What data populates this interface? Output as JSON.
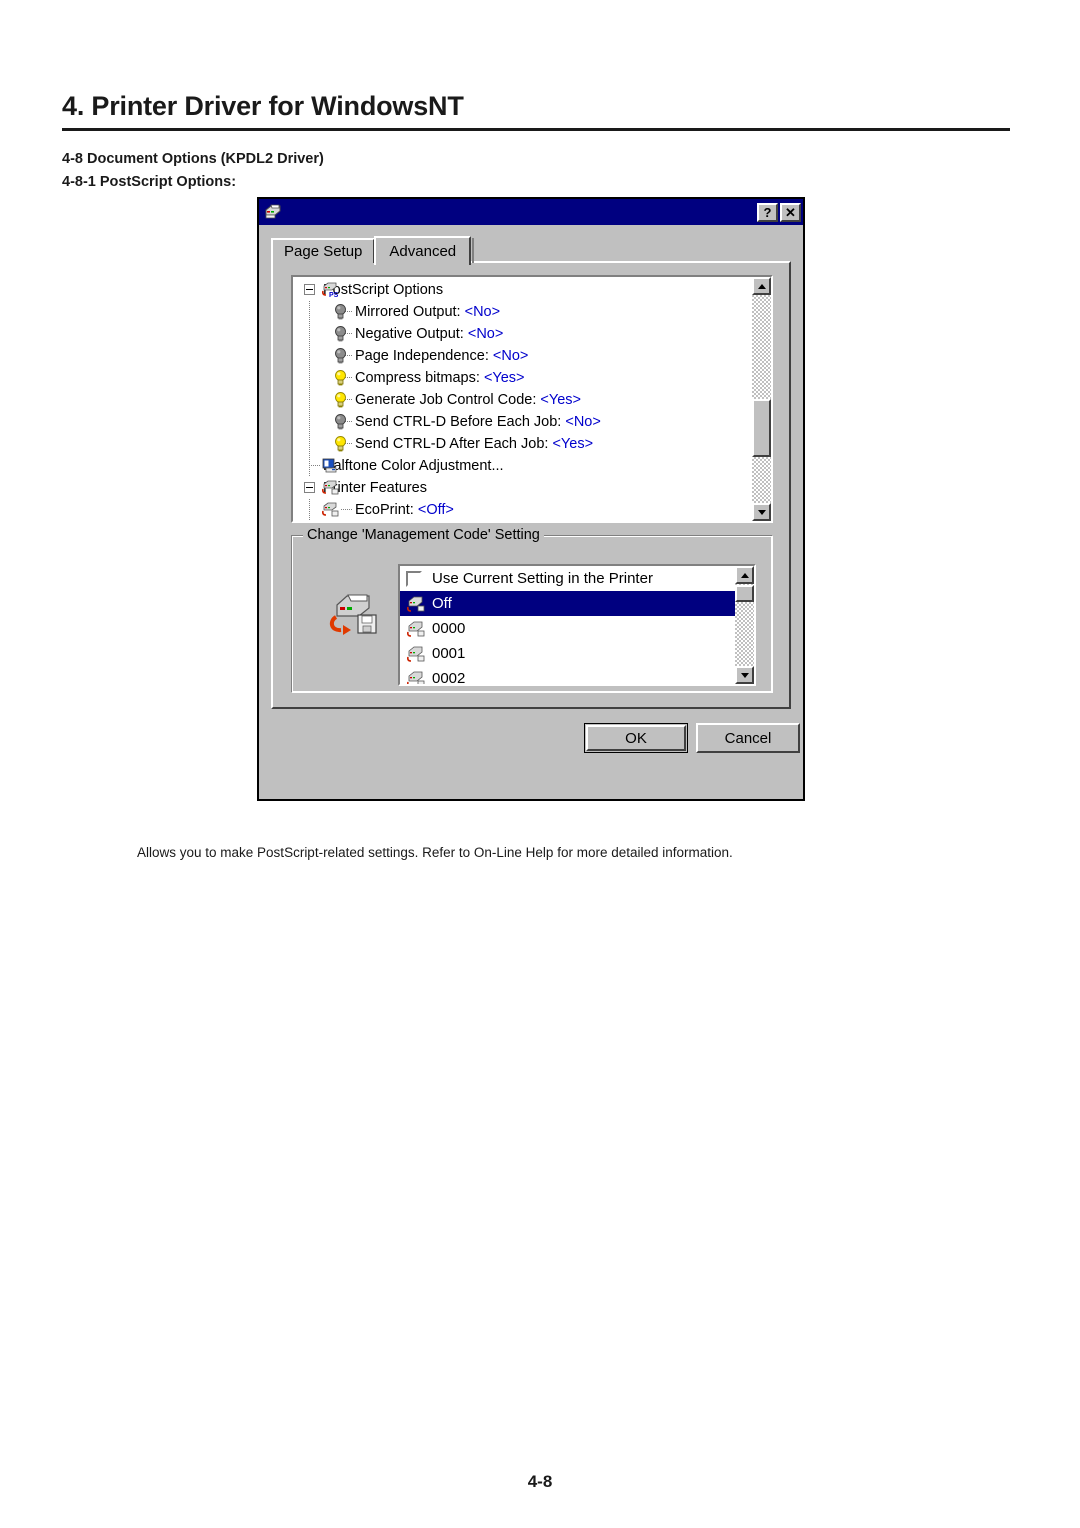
{
  "document": {
    "chapter_title": "4. Printer Driver for WindowsNT",
    "section_lines": [
      "4-8 Document Options (KPDL2 Driver)",
      "4-8-1 PostScript Options:"
    ],
    "caption": "Allows you to make PostScript-related settings. Refer to On-Line Help for more detailed information.",
    "page_number": "4-8"
  },
  "dialog": {
    "title": "",
    "titlebar_color": "#000080",
    "face_color": "#c0c0c0",
    "icons": {
      "window": "printer-icon",
      "help_button": "?",
      "close_button": "✕"
    },
    "tabs": [
      {
        "label": "Page Setup",
        "active": false
      },
      {
        "label": "Advanced",
        "active": true
      }
    ],
    "tree": {
      "rows": [
        {
          "label": "PostScript Options",
          "value": "",
          "icon": "printer-ps-icon",
          "level": 0,
          "expander": "minus"
        },
        {
          "label": "Mirrored Output:",
          "value": "<No>",
          "icon": "bulb-off-icon",
          "level": 1,
          "expander": ""
        },
        {
          "label": "Negative Output:",
          "value": "<No>",
          "icon": "bulb-off-icon",
          "level": 1,
          "expander": ""
        },
        {
          "label": "Page Independence:",
          "value": "<No>",
          "icon": "bulb-off-icon",
          "level": 1,
          "expander": ""
        },
        {
          "label": "Compress bitmaps:",
          "value": "<Yes>",
          "icon": "bulb-on-icon",
          "level": 1,
          "expander": ""
        },
        {
          "label": "Generate Job Control Code:",
          "value": "<Yes>",
          "icon": "bulb-on-icon",
          "level": 1,
          "expander": ""
        },
        {
          "label": "Send CTRL-D Before Each Job:",
          "value": "<No>",
          "icon": "bulb-off-icon",
          "level": 1,
          "expander": ""
        },
        {
          "label": "Send CTRL-D After Each Job:",
          "value": "<Yes>",
          "icon": "bulb-on-icon",
          "level": 1,
          "expander": ""
        },
        {
          "label": "Halftone Color Adjustment...",
          "value": "",
          "icon": "halftone-icon",
          "level": 0,
          "expander": ""
        },
        {
          "label": "Printer Features",
          "value": "",
          "icon": "printer-feature-icon",
          "level": 0,
          "expander": "minus"
        },
        {
          "label": "EcoPrint:",
          "value": "<Off>",
          "icon": "printer-feature-icon",
          "level": 1,
          "expander": ""
        }
      ],
      "value_color": "#0000cc",
      "scrollbar": {
        "thumb_position_pct": 47
      }
    },
    "group": {
      "legend": "Change 'Management Code' Setting",
      "icon": "printer-save-icon",
      "list": {
        "items": [
          {
            "label": "Use Current Setting in the Printer",
            "icon": "checkbox-unchecked-icon",
            "selected": false
          },
          {
            "label": "Off",
            "icon": "printer-code-icon",
            "selected": true
          },
          {
            "label": "0000",
            "icon": "printer-code-icon",
            "selected": false
          },
          {
            "label": "0001",
            "icon": "printer-code-icon",
            "selected": false
          },
          {
            "label": "0002",
            "icon": "printer-code-icon",
            "selected": false
          }
        ],
        "selection_color": "#000080",
        "scrollbar": {
          "thumb_position_pct": 5
        }
      }
    },
    "buttons": {
      "ok": "OK",
      "cancel": "Cancel",
      "default": "ok"
    }
  }
}
